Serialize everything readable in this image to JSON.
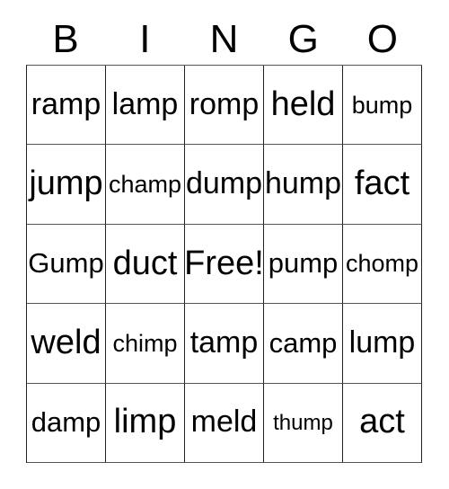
{
  "card": {
    "title": "BINGO",
    "headers": [
      "B",
      "I",
      "N",
      "G",
      "O"
    ],
    "rows": [
      [
        {
          "text": "ramp",
          "size": "lg"
        },
        {
          "text": "lamp",
          "size": "lg"
        },
        {
          "text": "romp",
          "size": "lg"
        },
        {
          "text": "held",
          "size": "xl"
        },
        {
          "text": "bump",
          "size": "sm"
        }
      ],
      [
        {
          "text": "jump",
          "size": "xl"
        },
        {
          "text": "champ",
          "size": "sm"
        },
        {
          "text": "dump",
          "size": "lg"
        },
        {
          "text": "hump",
          "size": "lg"
        },
        {
          "text": "fact",
          "size": "xl"
        }
      ],
      [
        {
          "text": "Gump",
          "size": "md"
        },
        {
          "text": "duct",
          "size": "xl"
        },
        {
          "text": "Free!",
          "size": "xl"
        },
        {
          "text": "pump",
          "size": "md"
        },
        {
          "text": "chomp",
          "size": "sm"
        }
      ],
      [
        {
          "text": "weld",
          "size": "xl"
        },
        {
          "text": "chimp",
          "size": "sm"
        },
        {
          "text": "tamp",
          "size": "lg"
        },
        {
          "text": "camp",
          "size": "md"
        },
        {
          "text": "lump",
          "size": "lg"
        }
      ],
      [
        {
          "text": "damp",
          "size": "md"
        },
        {
          "text": "limp",
          "size": "xl"
        },
        {
          "text": "meld",
          "size": "lg"
        },
        {
          "text": "thump",
          "size": "xs"
        },
        {
          "text": "act",
          "size": "xl"
        }
      ]
    ],
    "free_space": {
      "row": 2,
      "col": 2,
      "label": "Free!"
    },
    "colors": {
      "text": "#000000",
      "background": "#ffffff",
      "grid_line": "#222222"
    }
  }
}
